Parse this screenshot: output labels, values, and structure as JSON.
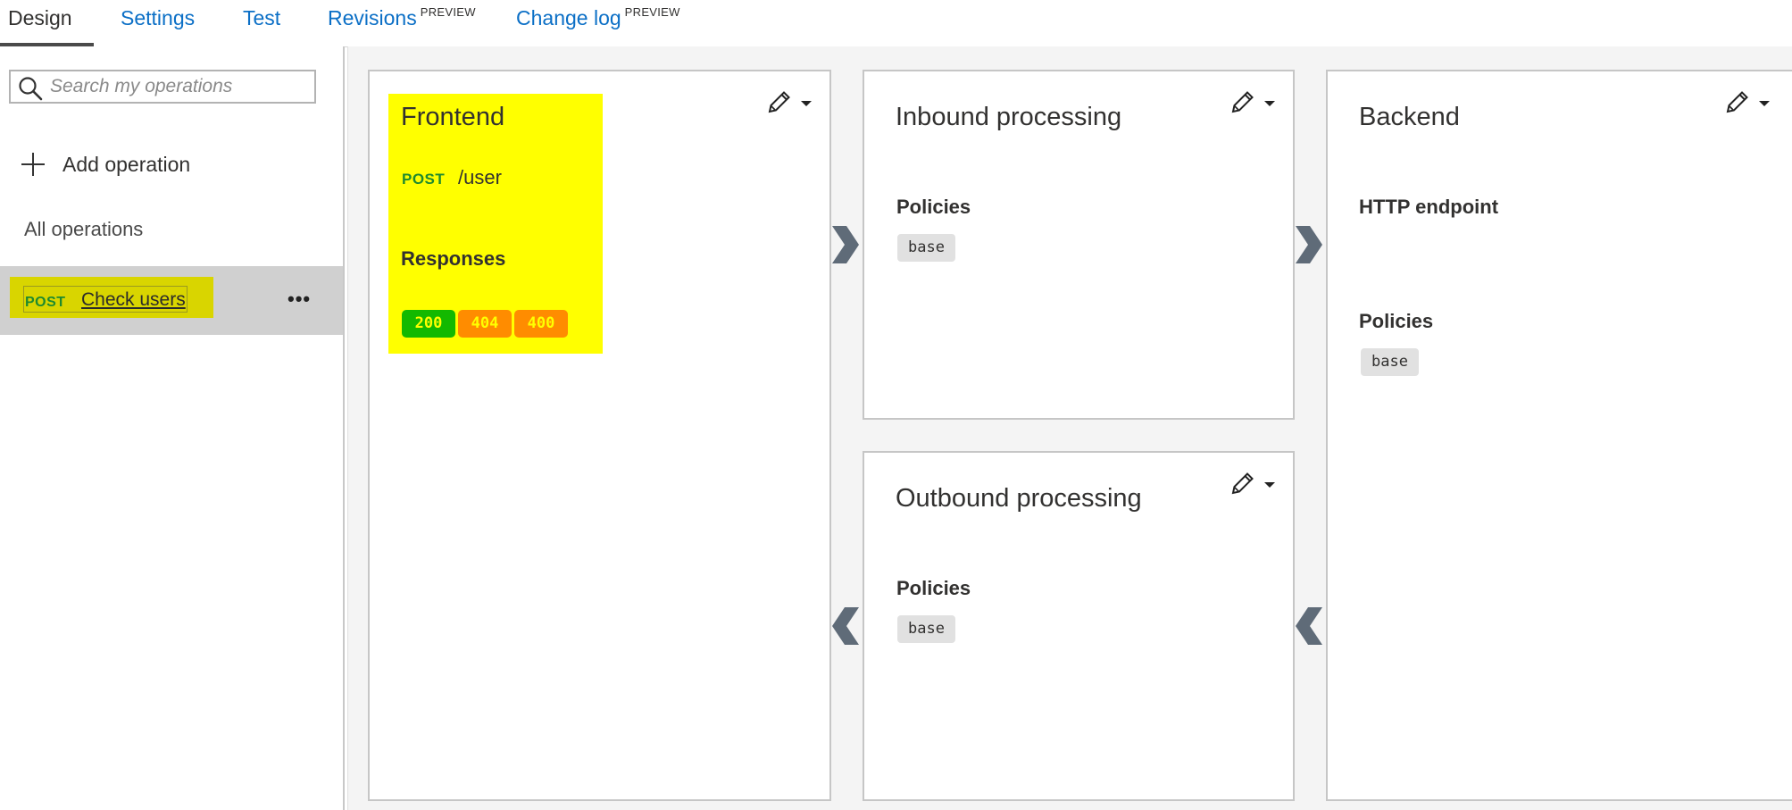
{
  "tabs": [
    {
      "label": "Design",
      "badge": ""
    },
    {
      "label": "Settings",
      "badge": ""
    },
    {
      "label": "Test",
      "badge": ""
    },
    {
      "label": "Revisions",
      "badge": "PREVIEW"
    },
    {
      "label": "Change log",
      "badge": "PREVIEW"
    }
  ],
  "active_tab": "Design",
  "sidebar": {
    "search_placeholder": "Search my operations",
    "add_operation_label": "Add operation",
    "all_operations_label": "All operations",
    "operations": [
      {
        "method": "POST",
        "name": "Check users",
        "more_label": "•••",
        "selected": true
      }
    ]
  },
  "frontend": {
    "title": "Frontend",
    "method": "POST",
    "path": "/user",
    "responses_label": "Responses",
    "responses": [
      {
        "code": "200",
        "color": "#13b900"
      },
      {
        "code": "404",
        "color": "#ff8c00"
      },
      {
        "code": "400",
        "color": "#ff8c00"
      }
    ],
    "highlight_color": "#ffff00"
  },
  "inbound": {
    "title": "Inbound processing",
    "policies_label": "Policies",
    "policy": "base"
  },
  "outbound": {
    "title": "Outbound processing",
    "policies_label": "Policies",
    "policy": "base"
  },
  "backend": {
    "title": "Backend",
    "endpoint_label": "HTTP endpoint",
    "policies_label": "Policies",
    "policy": "base"
  },
  "icons": {
    "search": "search-icon",
    "add": "plus-icon",
    "edit": "pencil-icon",
    "dropdown": "caret-down-icon",
    "flow_right": "chevron-right-icon",
    "flow_left": "chevron-left-icon"
  },
  "colors": {
    "link": "#0b6fc6",
    "method_post": "#1e8a2e",
    "selected_row": "#d0d0d0",
    "operation_highlight": "#d9d500",
    "arrow": "#5f6b78"
  }
}
